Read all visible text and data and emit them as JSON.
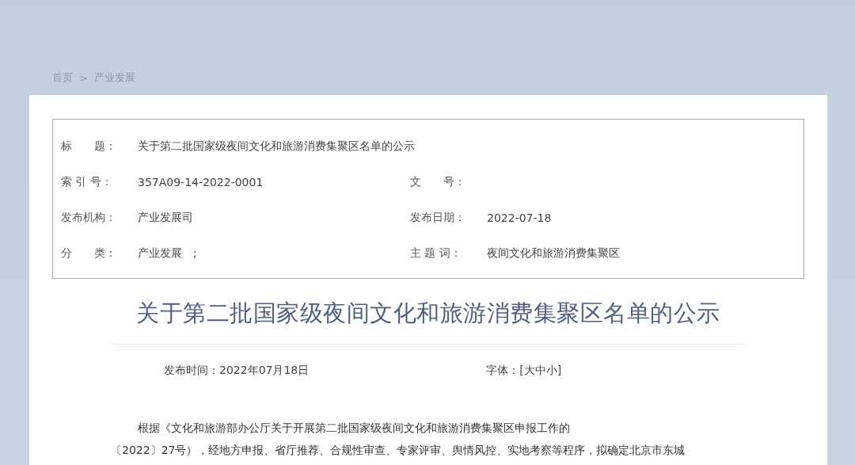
{
  "breadcrumb": {
    "items": [
      "首页",
      "产业发展"
    ],
    "separator": ">"
  },
  "meta_title": {
    "label": "标　　题：",
    "value": "关于第二批国家级夜间文化和旅游消费集聚区名单的公示"
  },
  "meta": [
    {
      "label": "索 引 号：",
      "value": "357A09-14-2022-0001"
    },
    {
      "label": "文　　号："
    },
    {
      "label": "发布机构：",
      "value": "产业发展司"
    },
    {
      "label": "发布日期：",
      "value": "2022-07-18"
    },
    {
      "label": "分　　类：",
      "value": "产业发展　;"
    },
    {
      "label": "主 题 词：",
      "value": "夜间文化和旅游消费集聚区"
    }
  ],
  "title": "关于第二批国家级夜间文化和旅游消费集聚区名单的公示",
  "publish_time": "发布时间：2022年07月18日",
  "font_size": {
    "label": "字体：",
    "options": [
      "[大中小]"
    ]
  },
  "body_lines": [
    "根据《文化和旅游部办公厅关于开展第二批国家级夜间文化和旅游消费集聚区申报工作的",
    "〔2022〕27号），经地方申报、省厅推荐、合规性审查、专家评审、舆情风控、实地考察等程序，拟确定北京市东城"
  ]
}
